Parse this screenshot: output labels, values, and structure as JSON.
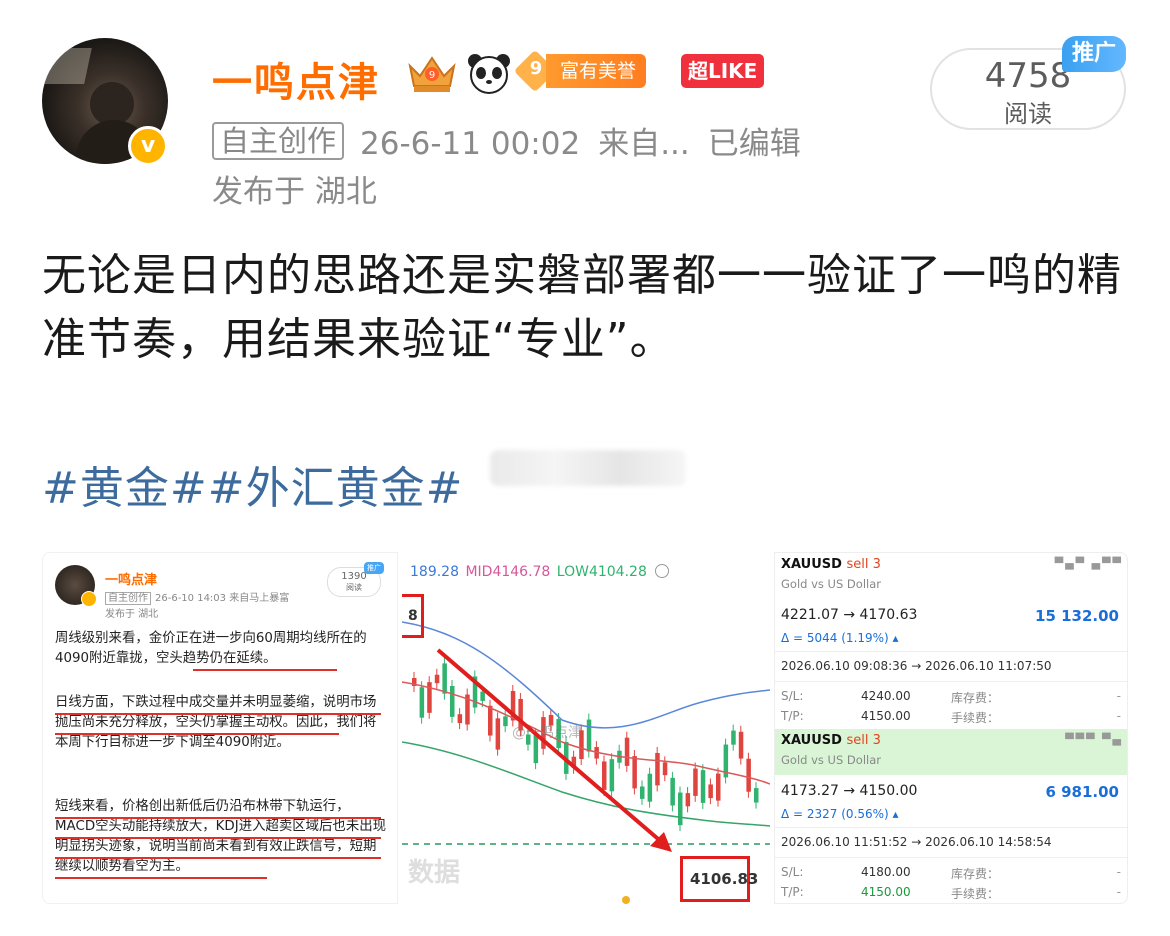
{
  "header": {
    "username": "一鸣点津",
    "fuyou_level": "9",
    "fuyou_label": "富有美誉",
    "chao_like": "超LIKE",
    "tag": "自主创作",
    "timestamp": "26-6-11 00:02",
    "source": "来自...",
    "edited": "已编辑",
    "location": "发布于 湖北",
    "read_count": "4758",
    "read_label": "阅读",
    "promo_badge": "推广"
  },
  "post": {
    "text": "无论是日内的思路还是实磐部署都一一验证了一鸣的精准节奏，用结果来验证“专业”。",
    "hashtags": "#黄金##外汇黄金#"
  },
  "image1": {
    "name": "一鸣点津",
    "tag": "自主创作",
    "time": "26-6-10 14:03",
    "source": "来自马上暴富",
    "location": "发布于 湖北",
    "read_count": "1390",
    "read_label": "阅读",
    "promo": "推广",
    "p1": "周线级别来看，金价正在进一步向60周期均线所在的4090附近靠拢，空头趋势仍在延续。",
    "p2": "日线方面，下跌过程中成交量并未明显萎缩，说明市场抛压尚未充分释放，空头仍掌握主动权。因此，我们将本周下行目标进一步下调至4090附近。",
    "p3": "短线来看，价格创出新低后仍沿布林带下轨运行，MACD空头动能持续放大，KDJ进入超卖区域后也未出现明显拐头迹象，说明当前尚未看到有效止跌信号，短期继续以顺势看空为主。"
  },
  "chart": {
    "header_a": "189.28",
    "header_mid": "MID4146.78",
    "header_low": "LOW4104.28",
    "left_label": "8",
    "price_label": "4106.83",
    "watermark": "@一鸣点津",
    "watermark2": "数据"
  },
  "trades": [
    {
      "symbol": "XAUUSD",
      "side": "sell 3",
      "desc": "Gold vs US Dollar",
      "price": "4221.07 → 4170.63",
      "profit": "15 132.00",
      "delta": "Δ = 5044 (1.19%) ▴",
      "time": "2026.06.10 09:08:36 → 2026.06.10 11:07:50",
      "sl_label": "S/L:",
      "sl": "4240.00",
      "tp_label": "T/P:",
      "tp": "4150.00",
      "swap_label": "库存费：",
      "swap": "-",
      "fee_label": "手续费：",
      "fee": "-"
    },
    {
      "symbol": "XAUUSD",
      "side": "sell 3",
      "desc": "Gold vs US Dollar",
      "price": "4173.27 → 4150.00",
      "profit": "6 981.00",
      "delta": "Δ = 2327 (0.56%) ▴",
      "time": "2026.06.10 11:51:52 → 2026.06.10 14:58:54",
      "sl_label": "S/L:",
      "sl": "4180.00",
      "tp_label": "T/P:",
      "tp": "4150.00",
      "swap_label": "库存费：",
      "swap": "-",
      "fee_label": "手续费：",
      "fee": "-"
    }
  ],
  "colors": {
    "username": "#ff6c00",
    "hashtag": "#3d6b9e",
    "accent_red": "#e01e1e",
    "profit_blue": "#1a6ed8"
  }
}
